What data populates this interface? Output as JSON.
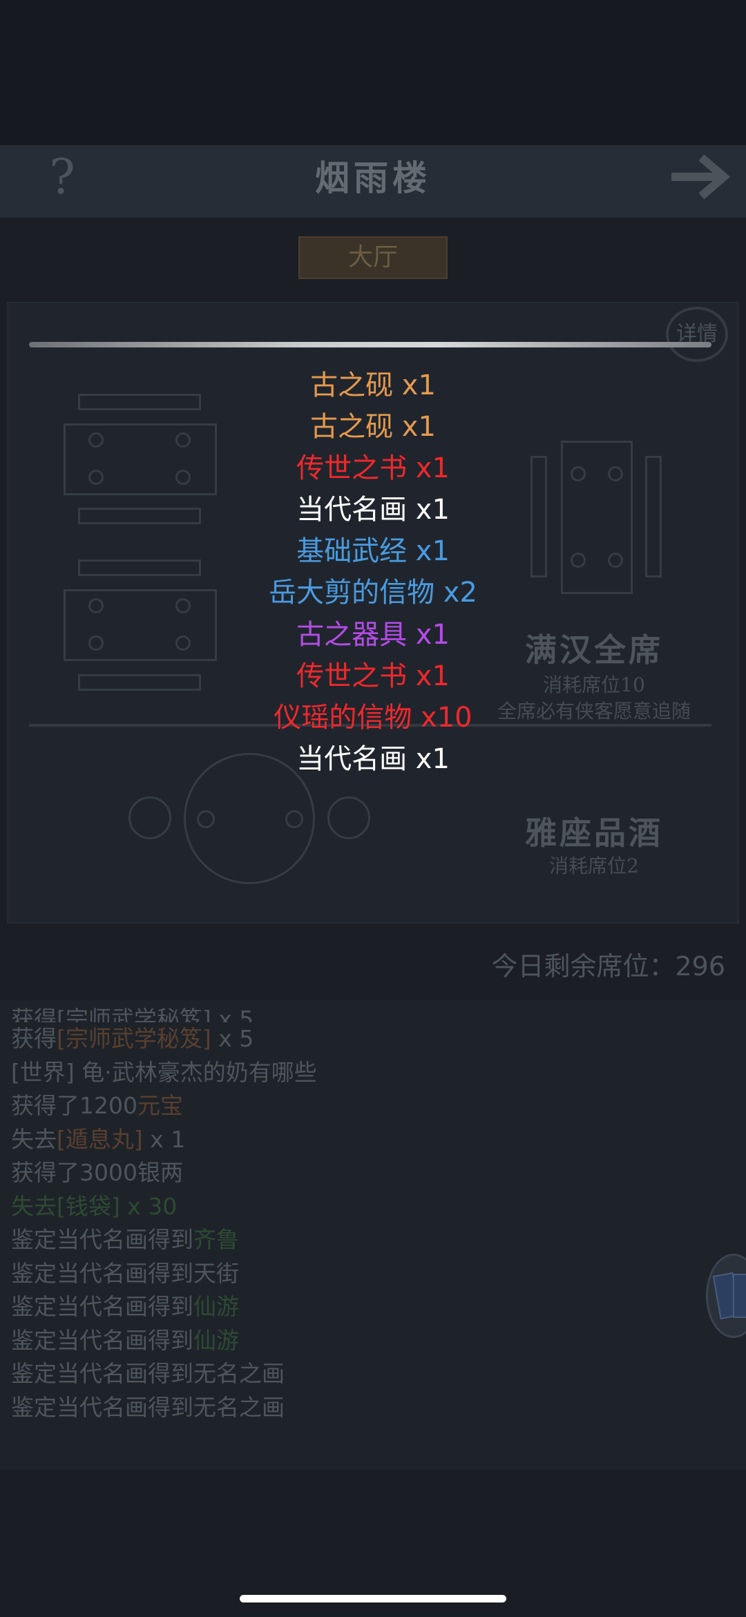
{
  "header": {
    "title": "烟雨楼",
    "help_icon": "question-mark-icon",
    "next_icon": "arrow-right-icon"
  },
  "tabs": [
    {
      "label": "大厅",
      "selected": true
    }
  ],
  "panel": {
    "detail_label": "详情",
    "feasts": [
      {
        "title": "满汉全席",
        "cost": "消耗席位10",
        "desc": "全席必有侠客愿意追随"
      },
      {
        "title": "雅座品酒",
        "cost": "消耗席位2"
      }
    ],
    "seats_remaining": "今日剩余席位：296"
  },
  "rewards": [
    {
      "name": "古之砚",
      "qty": "x1",
      "color": "#e59a4e"
    },
    {
      "name": "古之砚",
      "qty": "x1",
      "color": "#e59a4e"
    },
    {
      "name": "传世之书",
      "qty": "x1",
      "color": "#f0282c"
    },
    {
      "name": "当代名画",
      "qty": "x1",
      "color": "#ffffff"
    },
    {
      "name": "基础武经",
      "qty": "x1",
      "color": "#4a9be0"
    },
    {
      "name": "岳大剪的信物",
      "qty": "x2",
      "color": "#4a9be0"
    },
    {
      "name": "古之器具",
      "qty": "x1",
      "color": "#b44ce8"
    },
    {
      "name": "传世之书",
      "qty": "x1",
      "color": "#f0282c"
    },
    {
      "name": "仪瑶的信物",
      "qty": "x10",
      "color": "#f0282c"
    },
    {
      "name": "当代名画",
      "qty": "x1",
      "color": "#ffffff"
    }
  ],
  "log": [
    {
      "parts": [
        {
          "t": "获得[宗师武学秘笈] x 5",
          "c": ""
        }
      ]
    },
    {
      "parts": [
        {
          "t": "获得",
          "c": ""
        },
        {
          "t": "[宗师武学秘笈]",
          "c": "c-orange"
        },
        {
          "t": " x 5",
          "c": ""
        }
      ]
    },
    {
      "parts": [
        {
          "t": "[世界] 龟·武林豪杰的奶有哪些",
          "c": ""
        }
      ]
    },
    {
      "parts": [
        {
          "t": "获得了1200",
          "c": ""
        },
        {
          "t": "元宝",
          "c": "c-orange"
        }
      ]
    },
    {
      "parts": [
        {
          "t": "失去",
          "c": ""
        },
        {
          "t": "[遁息丸]",
          "c": "c-orange"
        },
        {
          "t": " x 1",
          "c": ""
        }
      ]
    },
    {
      "parts": [
        {
          "t": "获得了3000银两",
          "c": ""
        }
      ]
    },
    {
      "parts": [
        {
          "t": "失去",
          "c": "c-green"
        },
        {
          "t": "[钱袋]",
          "c": "c-green"
        },
        {
          "t": " x 30",
          "c": "c-green"
        }
      ]
    },
    {
      "parts": [
        {
          "t": "鉴定当代名画得到",
          "c": ""
        },
        {
          "t": "齐鲁",
          "c": "c-green"
        }
      ]
    },
    {
      "parts": [
        {
          "t": "鉴定当代名画得到天街",
          "c": ""
        }
      ]
    },
    {
      "parts": [
        {
          "t": "鉴定当代名画得到",
          "c": ""
        },
        {
          "t": "仙游",
          "c": "c-green"
        }
      ]
    },
    {
      "parts": [
        {
          "t": "鉴定当代名画得到",
          "c": ""
        },
        {
          "t": "仙游",
          "c": "c-green"
        }
      ]
    },
    {
      "parts": [
        {
          "t": "鉴定当代名画得到无名之画",
          "c": ""
        }
      ]
    },
    {
      "parts": [
        {
          "t": "鉴定当代名画得到无名之画",
          "c": ""
        }
      ]
    }
  ]
}
